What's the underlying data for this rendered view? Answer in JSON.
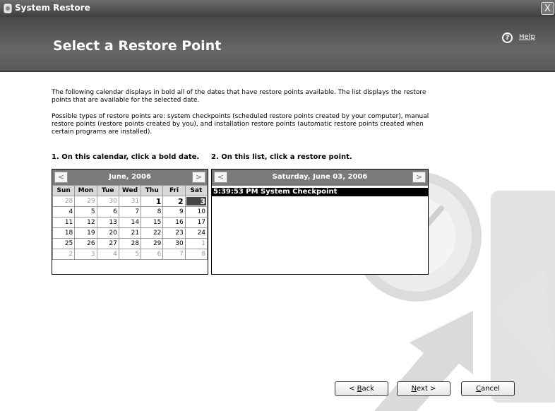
{
  "window": {
    "title": "System Restore",
    "close_label": "X"
  },
  "header": {
    "title": "Select a Restore Point",
    "help_label": "Help",
    "help_glyph": "?"
  },
  "intro": {
    "p1": "The following calendar displays in bold all of the dates that have restore points available. The list displays the restore points that are available for the selected date.",
    "p2": "Possible types of restore points are: system checkpoints (scheduled restore points created by your computer), manual restore points (restore points created by you), and installation restore points (automatic restore points created when certain programs are installed)."
  },
  "steps": {
    "calendar_label": "1. On this calendar, click a bold date.",
    "list_label": "2. On this list, click a restore point."
  },
  "calendar": {
    "month": "June, 2006",
    "prev": "<",
    "next": ">",
    "weekdays": [
      "Sun",
      "Mon",
      "Tue",
      "Wed",
      "Thu",
      "Fri",
      "Sat"
    ],
    "weeks": [
      [
        "28",
        "29",
        "30",
        "31",
        "1",
        "2",
        "3"
      ],
      [
        "4",
        "5",
        "6",
        "7",
        "8",
        "9",
        "10"
      ],
      [
        "11",
        "12",
        "13",
        "14",
        "15",
        "16",
        "17"
      ],
      [
        "18",
        "19",
        "20",
        "21",
        "22",
        "23",
        "24"
      ],
      [
        "25",
        "26",
        "27",
        "28",
        "29",
        "30",
        "1"
      ],
      [
        "2",
        "3",
        "4",
        "5",
        "6",
        "7",
        "8"
      ]
    ],
    "selected_date": "3",
    "bold_dates": [
      "1",
      "2",
      "3"
    ]
  },
  "restore_list": {
    "date": "Saturday, June 03, 2006",
    "prev": "<",
    "next": ">",
    "items": [
      {
        "time": "5:39:53 PM",
        "description": "System Checkpoint",
        "selected": true
      }
    ]
  },
  "buttons": {
    "back": {
      "prefix": "< ",
      "accel": "B",
      "rest": "ack"
    },
    "next": {
      "prefix": "",
      "accel": "N",
      "rest": "ext >"
    },
    "cancel": {
      "prefix": "",
      "accel": "C",
      "rest": "ancel"
    }
  }
}
